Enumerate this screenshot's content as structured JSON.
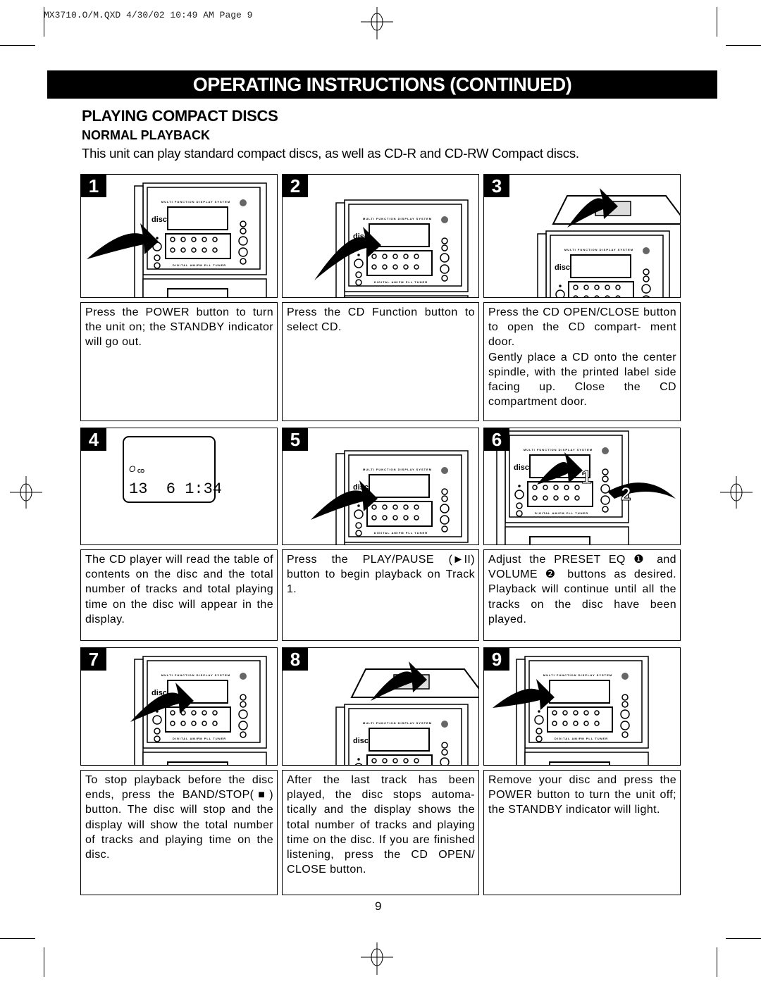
{
  "slug": "MX3710.O/M.QXD  4/30/02  10:49 AM  Page 9",
  "banner": "OPERATING INSTRUCTIONS (CONTINUED)",
  "section_title": "PLAYING COMPACT DISCS",
  "subsection_title": "NORMAL PLAYBACK",
  "intro": "This unit can play standard compact discs, as well as CD-R and CD-RW Compact discs.",
  "device_labels": {
    "top": "MULTI FUNCTION DISPLAY SYSTEM",
    "bottom": "DIGITAL AM/FM PLL TUNER",
    "logo": "disc"
  },
  "display": {
    "indicator": "CD",
    "readout": "13  6 1:34"
  },
  "step6_callouts": [
    "1",
    "2"
  ],
  "steps": [
    {
      "number": "1",
      "text": "Press the POWER button to turn the unit on; the STANDBY indicator will go out."
    },
    {
      "number": "2",
      "text": "Press the CD Function button to select CD."
    },
    {
      "number": "3",
      "text": "Press the CD OPEN/CLOSE button to open the CD compart- ment door.",
      "text2": "Gently place a CD onto the center spindle, with the printed label side facing up. Close the CD compartment door."
    },
    {
      "number": "4",
      "text": "The CD player will read the table of contents on the disc and the total number of tracks and total playing time on the disc will appear in the display."
    },
    {
      "number": "5",
      "text": "Press the PLAY/PAUSE (►II) button to begin playback on Track 1."
    },
    {
      "number": "6",
      "text": "Adjust the PRESET EQ ❶ and VOLUME ❷ buttons as desired. Playback will continue until all the tracks on the disc have been played."
    },
    {
      "number": "7",
      "text": "To stop playback before the disc ends, press the BAND/STOP(■) button. The disc will stop and the display will show the total number of tracks and playing time on the disc."
    },
    {
      "number": "8",
      "text": "After the last track has been played, the disc stops automa- tically and the display shows the total number of tracks and playing time on the disc. If you are finished listening, press the CD OPEN/ CLOSE button."
    },
    {
      "number": "9",
      "text": "Remove your disc and press the POWER button to turn the unit off;  the STANDBY indicator will light."
    }
  ],
  "page_number": "9"
}
